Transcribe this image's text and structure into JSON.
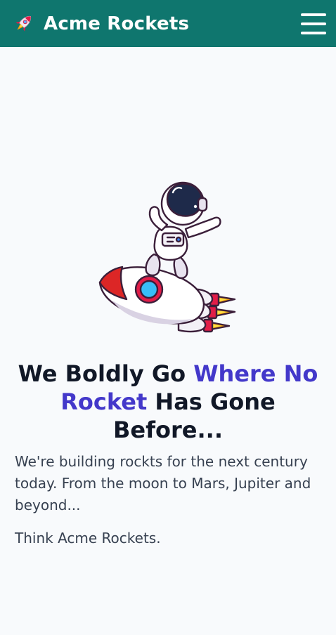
{
  "navbar": {
    "brand_icon": "rocket-icon",
    "brand_title": "Acme Rockets",
    "menu_icon": "hamburger-menu-icon",
    "color": "#0f766e"
  },
  "hero": {
    "image_icon": "astronaut-riding-rocket-illustration",
    "headline": {
      "part1": "We Boldly Go ",
      "highlight1": "Where No Rocket",
      "part2": " Has Gone Before...",
      "highlight_color": "#4338ca"
    },
    "paragraph1": "We're building rockts for the next century today. From the moon to Mars, Jupiter and beyond...",
    "paragraph2": "Think Acme Rockets."
  }
}
